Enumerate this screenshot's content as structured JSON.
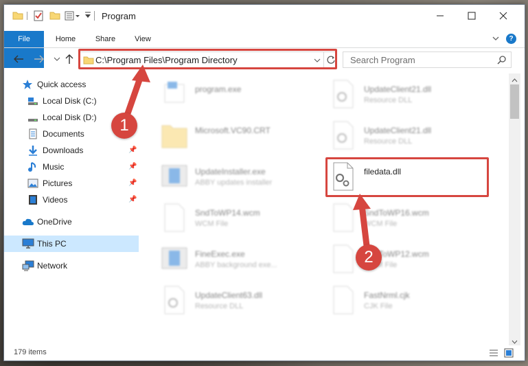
{
  "window": {
    "title": "Program",
    "accent_color": "#1979ca",
    "highlight_color": "#d6463f",
    "selection_color": "#cce8ff"
  },
  "ribbon": {
    "tabs": [
      {
        "label": "File",
        "active": true
      },
      {
        "label": "Home"
      },
      {
        "label": "Share"
      },
      {
        "label": "View"
      }
    ]
  },
  "address": {
    "path": "C:\\Program Files\\Program Directory"
  },
  "search": {
    "placeholder": "Search Program"
  },
  "sidebar": {
    "items": [
      {
        "label": "Quick access",
        "icon": "star-icon"
      },
      {
        "label": "Local Disk (C:)",
        "icon": "drive-icon"
      },
      {
        "label": "Local Disk (D:)",
        "icon": "drive-icon"
      },
      {
        "label": "Documents",
        "icon": "documents-icon"
      },
      {
        "label": "Downloads",
        "icon": "download-icon",
        "pinned": true
      },
      {
        "label": "Music",
        "icon": "music-icon",
        "pinned": true
      },
      {
        "label": "Pictures",
        "icon": "pictures-icon",
        "pinned": true
      },
      {
        "label": "Videos",
        "icon": "videos-icon",
        "pinned": true
      },
      {
        "label": "OneDrive",
        "icon": "cloud-icon"
      },
      {
        "label": "This PC",
        "icon": "computer-icon",
        "selected": true
      },
      {
        "label": "Network",
        "icon": "network-icon"
      }
    ]
  },
  "files": [
    {
      "name": "program.exe",
      "type": ""
    },
    {
      "name": "UpdateClient21.dll",
      "type": "Resource DLL"
    },
    {
      "name": "Microsoft.VC90.CRT",
      "type": ""
    },
    {
      "name": "UpdateClient21.dll",
      "type": "Resource DLL"
    },
    {
      "name": "UpdateInstaller.exe",
      "type": "ABBY updates installer"
    },
    {
      "name": "filedata.dll",
      "type": ""
    },
    {
      "name": "SndToWP14.wcm",
      "type": "WCM File"
    },
    {
      "name": "SndToWP16.wcm",
      "type": "WCM File"
    },
    {
      "name": "FineExec.exe",
      "type": "ABBY background exe..."
    },
    {
      "name": "SndToWP12.wcm",
      "type": "WCM File"
    },
    {
      "name": "UpdateClient63.dll",
      "type": "Resource DLL"
    },
    {
      "name": "FastNrml.cjk",
      "type": "CJK File"
    }
  ],
  "status": {
    "item_count": "179 items"
  },
  "annotations": {
    "step1": "1",
    "step2": "2"
  }
}
